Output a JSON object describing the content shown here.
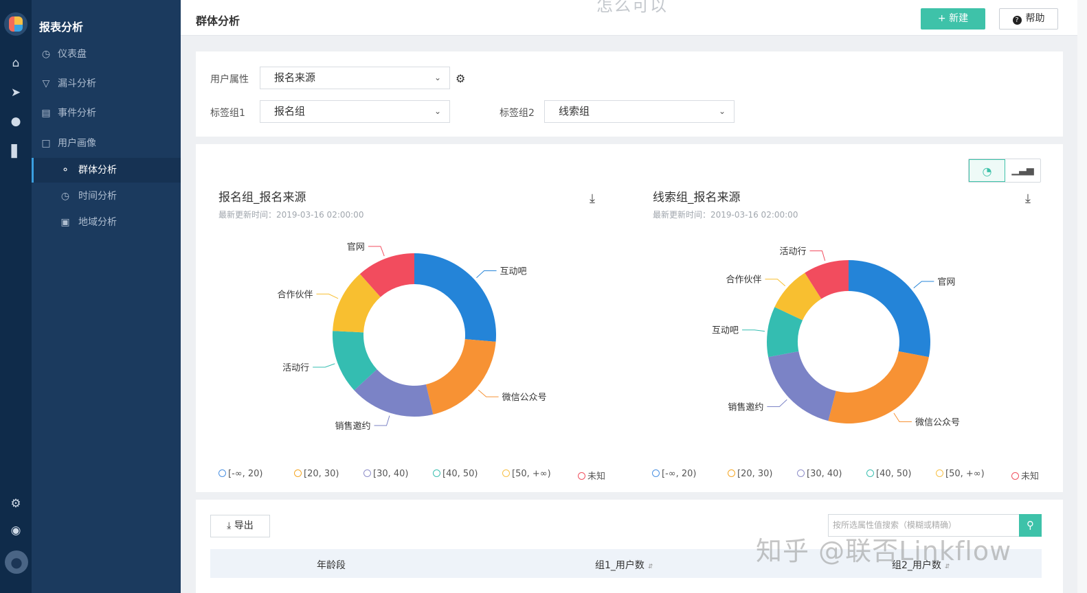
{
  "app": {
    "section_title": "报表分析"
  },
  "header": {
    "page_title": "群体分析",
    "new_label": "+ 新建",
    "help_label": "帮助",
    "top_watermark": "怎么可以"
  },
  "menu": {
    "items": [
      {
        "label": "仪表盘",
        "icon": "dashboard-icon"
      },
      {
        "label": "漏斗分析",
        "icon": "funnel-icon"
      },
      {
        "label": "事件分析",
        "icon": "event-icon"
      },
      {
        "label": "用户画像",
        "icon": "folder-icon"
      },
      {
        "label": "群体分析",
        "icon": "group-icon",
        "active": true
      },
      {
        "label": "时间分析",
        "icon": "clock-icon"
      },
      {
        "label": "地域分析",
        "icon": "map-icon"
      }
    ]
  },
  "filters": {
    "user_attr_label": "用户属性",
    "user_attr_value": "报名来源",
    "tag1_label": "标签组1",
    "tag1_value": "报名组",
    "tag2_label": "标签组2",
    "tag2_value": "线索组"
  },
  "charts": {
    "left": {
      "title": "报名组_报名来源",
      "updated": "最新更新时间：2019-03-16 02:00:00"
    },
    "right": {
      "title": "线索组_报名来源",
      "updated": "最新更新时间：2019-03-16 02:00:00"
    },
    "legend": [
      "[-∞, 20)",
      "[20, 30)",
      "[30, 40)",
      "[40, 50)",
      "[50, +∞)",
      "未知"
    ],
    "legend_colors": [
      "#4a90e2",
      "#f5a623",
      "#8e8ec9",
      "#3bbfb0",
      "#f7c046",
      "#f0505f"
    ]
  },
  "chart_data": [
    {
      "type": "pie",
      "title": "报名组_报名来源",
      "categories": [
        "互动吧",
        "微信公众号",
        "销售邀约",
        "活动行",
        "合作伙伴",
        "官网"
      ],
      "values": [
        25,
        19,
        16,
        12,
        12,
        11
      ],
      "colors": [
        "#2484d8",
        "#f79234",
        "#7b83c6",
        "#34bdb1",
        "#f8bf30",
        "#f24c5e"
      ]
    },
    {
      "type": "pie",
      "title": "线索组_报名来源",
      "categories": [
        "官网",
        "微信公众号",
        "销售邀约",
        "互动吧",
        "合作伙伴",
        "活动行"
      ],
      "values": [
        28,
        26,
        18,
        10,
        9,
        9
      ],
      "colors": [
        "#2484d8",
        "#f79234",
        "#7b83c6",
        "#34bdb1",
        "#f8bf30",
        "#f24c5e"
      ]
    }
  ],
  "table": {
    "export_label": "导出",
    "search_placeholder": "按所选属性值搜索（模糊或精确）",
    "col_age": "年龄段",
    "col_g1": "组1_用户数",
    "col_g2": "组2_用户数"
  },
  "watermark": "知乎 @联否Linkflow"
}
